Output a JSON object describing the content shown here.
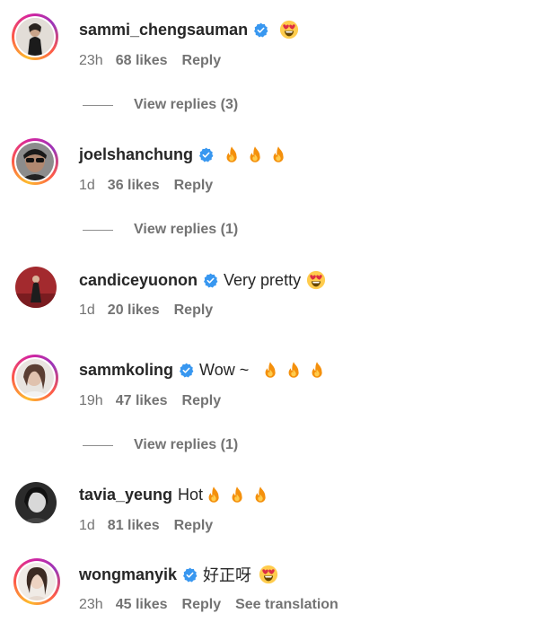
{
  "comments": [
    {
      "username": "sammi_chengsauman",
      "verified": true,
      "text": "",
      "emojis": [
        "heart-eyes-icon"
      ],
      "time": "23h",
      "likes": "68 likes",
      "reply": "Reply",
      "view_replies": "View replies (3)"
    },
    {
      "username": "joelshanchung",
      "verified": true,
      "text": "",
      "emojis": [
        "fire-icon",
        "fire-icon",
        "fire-icon"
      ],
      "time": "1d",
      "likes": "36 likes",
      "reply": "Reply",
      "view_replies": "View replies (1)"
    },
    {
      "username": "candiceyuonon",
      "verified": true,
      "text": "Very pretty",
      "emojis": [
        "heart-eyes-icon"
      ],
      "time": "1d",
      "likes": "20 likes",
      "reply": "Reply"
    },
    {
      "username": "sammkoling",
      "verified": true,
      "text": "Wow ~",
      "emojis": [
        "fire-icon",
        "fire-icon",
        "fire-icon"
      ],
      "time": "19h",
      "likes": "47 likes",
      "reply": "Reply",
      "view_replies": "View replies (1)"
    },
    {
      "username": "tavia_yeung",
      "verified": false,
      "text": "Hot",
      "emojis": [
        "fire-icon",
        "fire-icon",
        "fire-icon"
      ],
      "time": "1d",
      "likes": "81 likes",
      "reply": "Reply"
    },
    {
      "username": "wongmanyik",
      "verified": true,
      "text": "好正呀",
      "emojis": [
        "heart-eyes-icon"
      ],
      "time": "23h",
      "likes": "45 likes",
      "reply": "Reply",
      "see_translation": "See translation"
    }
  ],
  "colors": {
    "verified_badge": "#3897f0",
    "secondary_text": "#737373",
    "primary_text": "#262626"
  }
}
